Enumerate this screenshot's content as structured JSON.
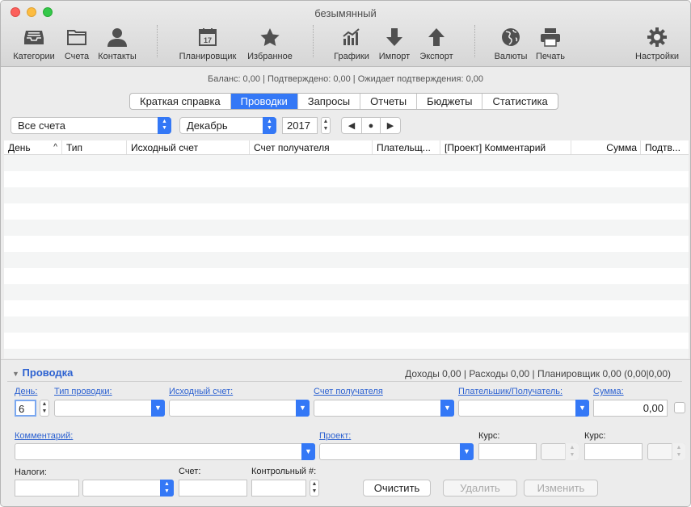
{
  "window": {
    "title": "безымянный"
  },
  "toolbar": [
    {
      "label": "Категории",
      "icon": "inbox-tray-icon"
    },
    {
      "label": "Счета",
      "icon": "folder-icon"
    },
    {
      "label": "Контакты",
      "icon": "person-icon"
    },
    {
      "label": "Планировщик",
      "icon": "calendar-icon",
      "badge": "17"
    },
    {
      "label": "Избранное",
      "icon": "star-icon"
    },
    {
      "label": "Графики",
      "icon": "chart-icon"
    },
    {
      "label": "Импорт",
      "icon": "arrow-down-icon"
    },
    {
      "label": "Экспорт",
      "icon": "arrow-up-icon"
    },
    {
      "label": "Валюты",
      "icon": "globe-icon"
    },
    {
      "label": "Печать",
      "icon": "printer-icon"
    },
    {
      "label": "Настройки",
      "icon": "gear-icon"
    }
  ],
  "balance": "Баланс: 0,00 | Подтверждено: 0,00 | Ожидает подтверждения: 0,00",
  "tabs": [
    {
      "label": "Краткая справка",
      "active": false
    },
    {
      "label": "Проводки",
      "active": true
    },
    {
      "label": "Запросы",
      "active": false
    },
    {
      "label": "Отчеты",
      "active": false
    },
    {
      "label": "Бюджеты",
      "active": false
    },
    {
      "label": "Статистика",
      "active": false
    }
  ],
  "filters": {
    "account": "Все счета",
    "month": "Декабрь",
    "year": "2017"
  },
  "table": {
    "columns": [
      "День",
      "Тип",
      "Исходный счет",
      "Счет получателя",
      "Плательщ...",
      "[Проект] Комментарий",
      "Сумма",
      "Подтв..."
    ],
    "sort_indicator": "^"
  },
  "panel": {
    "title": "Проводка",
    "stats": "Доходы 0,00 | Расходы 0,00 | Планировщик 0,00 (0,00|0,00)",
    "labels": {
      "day": "День:",
      "type": "Тип проводки:",
      "source": "Исходный счет:",
      "dest": "Счет получателя",
      "payer": "Плательшик/Получатель:",
      "amount": "Сумма:",
      "comment": "Комментарий:",
      "project": "Проект:",
      "rate1": "Курс:",
      "rate2": "Курс:",
      "taxes": "Налоги:",
      "account": "Счет:",
      "control": "Контрольный #:"
    },
    "values": {
      "day": "6",
      "amount": "0,00"
    },
    "buttons": {
      "clear": "Очистить",
      "delete": "Удалить",
      "change": "Изменить"
    }
  }
}
